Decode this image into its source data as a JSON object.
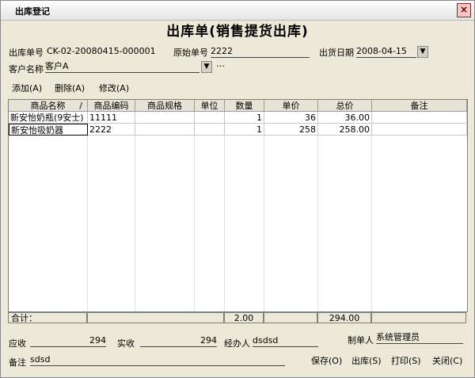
{
  "window": {
    "title": "出库登记",
    "close_symbol": "×"
  },
  "doc_title": "出库单(销售提货出库)",
  "header": {
    "order_no_label": "出库单号",
    "order_no": "CK-02-20080415-000001",
    "orig_no_label": "原始单号",
    "orig_no": "2222",
    "date_label": "出货日期",
    "date": "2008-04-15",
    "customer_label": "客户名称",
    "customer": "客户A",
    "customer_more": "…"
  },
  "toolbar": {
    "add": "添加(A)",
    "delete": "删除(A)",
    "edit": "修改(A)"
  },
  "table": {
    "columns": [
      "商品名称",
      "商品编码",
      "商品规格",
      "单位",
      "数量",
      "单价",
      "总价",
      "备注"
    ],
    "sort_indicator": "/",
    "rows": [
      [
        "新安怡奶瓶(9安士)",
        "11111",
        "",
        "",
        "1",
        "36",
        "36.00",
        ""
      ],
      [
        "新安怡吸奶器",
        "2222",
        "",
        "",
        "1",
        "258",
        "258.00",
        ""
      ]
    ]
  },
  "totals": {
    "label": "合计：",
    "qty": "2.00",
    "amount": "294.00"
  },
  "bottom": {
    "receivable_label": "应收",
    "receivable": "294",
    "received_label": "实收",
    "received": "294",
    "handler_label": "经办人",
    "handler": "dsdsd",
    "maker_label": "制单人",
    "maker": "系统管理员",
    "remark_label": "备注",
    "remark": "sdsd"
  },
  "buttons": {
    "save": "保存(O)",
    "outbound": "出库(S)",
    "print": "打印(S)",
    "close": "关闭(C)"
  }
}
